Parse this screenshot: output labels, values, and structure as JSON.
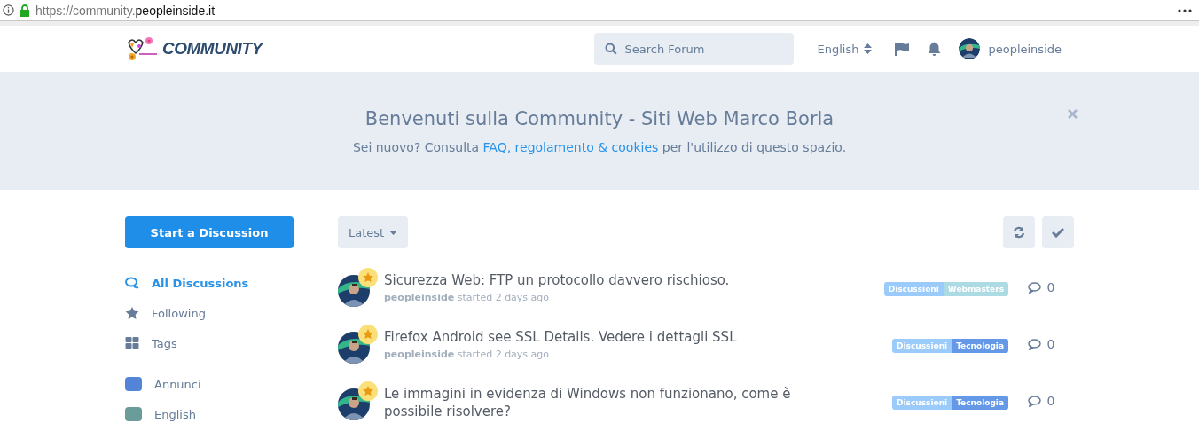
{
  "address_bar": {
    "url_prefix": "https://community.",
    "url_domain": "peopleinside.it",
    "secure": true
  },
  "header": {
    "logo_text": "COMMUNITY",
    "search": {
      "placeholder": "Search Forum"
    },
    "language": "English",
    "username": "peopleinside"
  },
  "hero": {
    "title": "Benvenuti sulla Community - Siti Web Marco Borla",
    "text_before": "Sei nuovo? Consulta",
    "link": "FAQ, regolamento & cookies",
    "text_after": "per l'utilizzo di questo spazio."
  },
  "sidebar": {
    "start_button": "Start a Discussion",
    "nav": [
      {
        "label": "All Discussions",
        "kind": "discussions",
        "selected": true
      },
      {
        "label": "Following",
        "kind": "star",
        "selected": false
      },
      {
        "label": "Tags",
        "kind": "tags",
        "selected": false
      }
    ],
    "tags": [
      {
        "label": "Annunci",
        "color": "#5284d8"
      },
      {
        "label": "English",
        "color": "#6a9c9a"
      }
    ]
  },
  "toolbar": {
    "sort": "Latest"
  },
  "discussions": [
    {
      "title": "Sicurezza Web: FTP un protocollo davvero rischioso.",
      "author": "peopleinside",
      "meta": "started 2 days ago",
      "tags": [
        {
          "label": "Discussioni",
          "color": "#9bcbfa"
        },
        {
          "label": "Webmasters",
          "color": "#acdbe4"
        }
      ],
      "replies": "0"
    },
    {
      "title": "Firefox Android see SSL Details. Vedere i dettagli SSL",
      "author": "peopleinside",
      "meta": "started 2 days ago",
      "tags": [
        {
          "label": "Discussioni",
          "color": "#9bcbfa"
        },
        {
          "label": "Tecnologia",
          "color": "#6599e8"
        }
      ],
      "replies": "0"
    },
    {
      "title": "Le immagini in evidenza di Windows non funzionano, come è possibile risolvere?",
      "tags": [
        {
          "label": "Discussioni",
          "color": "#9bcbfa"
        },
        {
          "label": "Tecnologia",
          "color": "#6599e8"
        }
      ],
      "replies": "0"
    }
  ]
}
